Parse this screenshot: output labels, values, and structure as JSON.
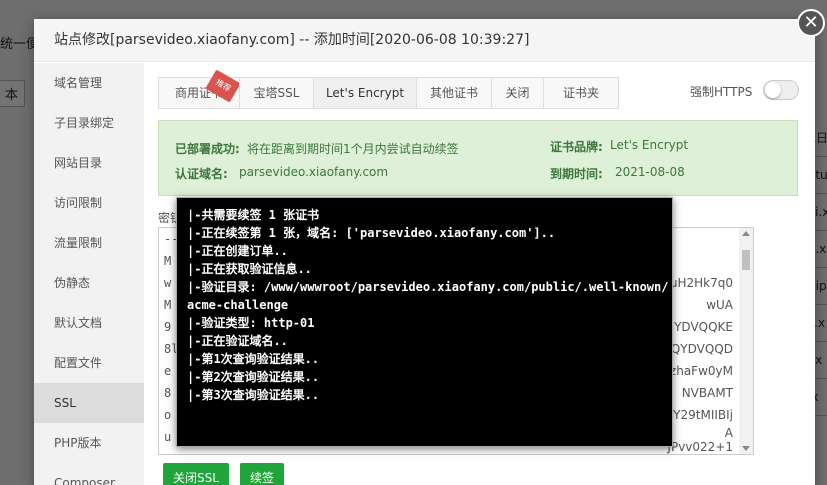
{
  "background": {
    "fragment_top_left": "统一便",
    "fragment_box_left": "本",
    "right_column": [
      "K日",
      "otu",
      "vi.x",
      "a.x",
      "hip",
      "v.x",
      "i.x",
      "ix"
    ]
  },
  "dialog": {
    "title": "站点修改[parsevideo.xiaofany.com] -- 添加时间[2020-06-08 10:39:27]",
    "close_symbol": "✕"
  },
  "sidebar": {
    "items": [
      {
        "label": "域名管理"
      },
      {
        "label": "子目录绑定"
      },
      {
        "label": "网站目录"
      },
      {
        "label": "访问限制"
      },
      {
        "label": "流量限制"
      },
      {
        "label": "伪静态"
      },
      {
        "label": "默认文档"
      },
      {
        "label": "配置文件"
      },
      {
        "label": "SSL",
        "active": true
      },
      {
        "label": "PHP版本"
      },
      {
        "label": "Composer"
      }
    ]
  },
  "tabs": {
    "items": [
      {
        "label": "商用证书"
      },
      {
        "label": "宝塔SSL"
      },
      {
        "label": "Let's Encrypt",
        "active": true
      },
      {
        "label": "其他证书"
      },
      {
        "label": "关闭"
      },
      {
        "label": "证书夹"
      }
    ],
    "badge": "推荐",
    "https_label": "强制HTTPS",
    "https_enabled": false
  },
  "info": {
    "deployed_label": "已部署成功:",
    "deployed_value": "将在距离到期时间1个月内尝试自动续签",
    "domain_label": "认证域名:",
    "domain_value": "parsevideo.xiaofany.com",
    "brand_label": "证书品牌:",
    "brand_value": "Let's Encrypt",
    "expire_label": "到期时间:",
    "expire_value": "2021-08-08"
  },
  "key_area": {
    "label": "密钥",
    "lines_left": [
      "--",
      "M",
      "w",
      "M",
      "9",
      "8l",
      "e",
      "8",
      "o",
      "u"
    ],
    "lines_right": [
      "",
      "",
      "uH2Hk7q0",
      "wUA",
      "YDVQQKE",
      "QYDVQQD",
      "zhaFw0yM",
      "NVBAMT",
      "Y29tMIIBIj",
      "A",
      "JPvv022+1"
    ]
  },
  "buttons": {
    "close_ssl": "关闭SSL",
    "renew": "续签"
  },
  "colors": {
    "accent_green": "#20a53a",
    "info_bg": "#dff0d8",
    "info_text": "#3c763d",
    "badge_red": "#d9534f"
  },
  "terminal": {
    "lines": [
      "|-共需要续签 1 张证书",
      "|-正在续签第 1 张，域名: ['parsevideo.xiaofany.com']..",
      "|-正在创建订单..",
      "|-正在获取验证信息..",
      "|-验证目录: /www/wwwroot/parsevideo.xiaofany.com/public/.well-known/",
      "acme-challenge",
      "|-验证类型: http-01",
      "|-正在验证域名..",
      "|-第1次查询验证结果..",
      "|-第2次查询验证结果..",
      "|-第3次查询验证结果.."
    ]
  }
}
